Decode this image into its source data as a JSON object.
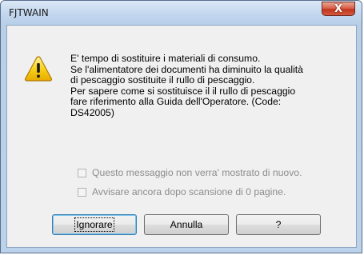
{
  "window": {
    "title": "FJTWAIN",
    "close_symbol": "X"
  },
  "icon": "warning-icon",
  "message": {
    "lines": [
      "E' tempo di sostituire i materiali di consumo.",
      "Se l'alimentatore dei documenti ha diminuito la qualità",
      "di pescaggio sostituite il rullo di pescaggio.",
      "Per sapere come si sostituisce il il rullo di pescaggio",
      "fare riferimento alla Guida dell'Operatore. (Code:",
      "DS42005)"
    ]
  },
  "checkboxes": [
    {
      "label": "Questo messaggio non verra' mostrato di nuovo.",
      "checked": false,
      "enabled": false
    },
    {
      "label": "Avvisare ancora dopo scansione di 0 pagine.",
      "checked": false,
      "enabled": false
    }
  ],
  "buttons": {
    "ignore": "Ignorare",
    "cancel": "Annulla",
    "help": "?"
  },
  "colors": {
    "frame": "#bcd2ea",
    "client": "#f0f0f0",
    "close_button": "#c1351e",
    "warning_fill": "#f5c400",
    "disabled_text": "#8d8d8d"
  }
}
